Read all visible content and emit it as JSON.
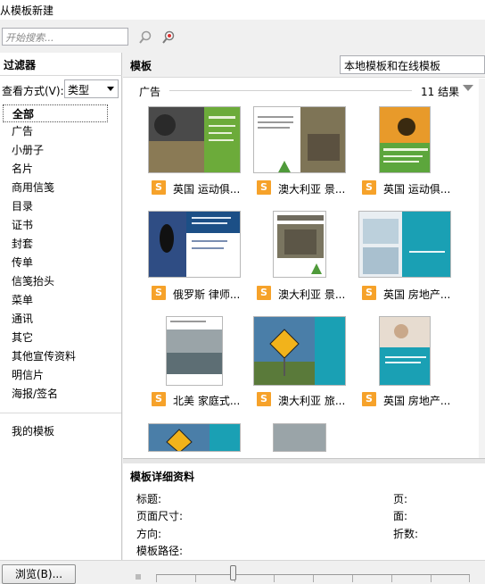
{
  "window": {
    "title": "从模板新建"
  },
  "search": {
    "placeholder": "开始搜索..."
  },
  "filters": {
    "title": "过滤器",
    "view_by_label": "查看方式(V):",
    "view_by_value": "类型",
    "categories": [
      "全部",
      "广告",
      "小册子",
      "名片",
      "商用信笺",
      "目录",
      "证书",
      "封套",
      "传单",
      "信笺抬头",
      "菜单",
      "通讯",
      "其它",
      "其他宣传资料",
      "明信片",
      "海报/签名"
    ],
    "selected": "全部",
    "my_templates": "我的模板"
  },
  "templates": {
    "title": "模板",
    "source_value": "本地模板和在线模板",
    "group_name": "广告",
    "result_count": "11 结果",
    "items": [
      {
        "caption": "英国 运动俱..."
      },
      {
        "caption": "澳大利亚 景..."
      },
      {
        "caption": "英国 运动俱..."
      },
      {
        "caption": "俄罗斯 律师..."
      },
      {
        "caption": "澳大利亚 景..."
      },
      {
        "caption": "英国 房地产..."
      },
      {
        "caption": "北美 家庭式..."
      },
      {
        "caption": "澳大利亚 旅..."
      },
      {
        "caption": "英国 房地产..."
      }
    ]
  },
  "details": {
    "title": "模板详细资料",
    "labels": {
      "title": "标题:",
      "page_size": "页面尺寸:",
      "orientation": "方向:",
      "path": "模板路径:",
      "pages": "页:",
      "sides": "面:",
      "folds": "折数:"
    }
  },
  "footer": {
    "browse_label": "浏览(B)..."
  },
  "colors": {
    "accent": "#f6a22a",
    "selected_border": "#555555"
  }
}
